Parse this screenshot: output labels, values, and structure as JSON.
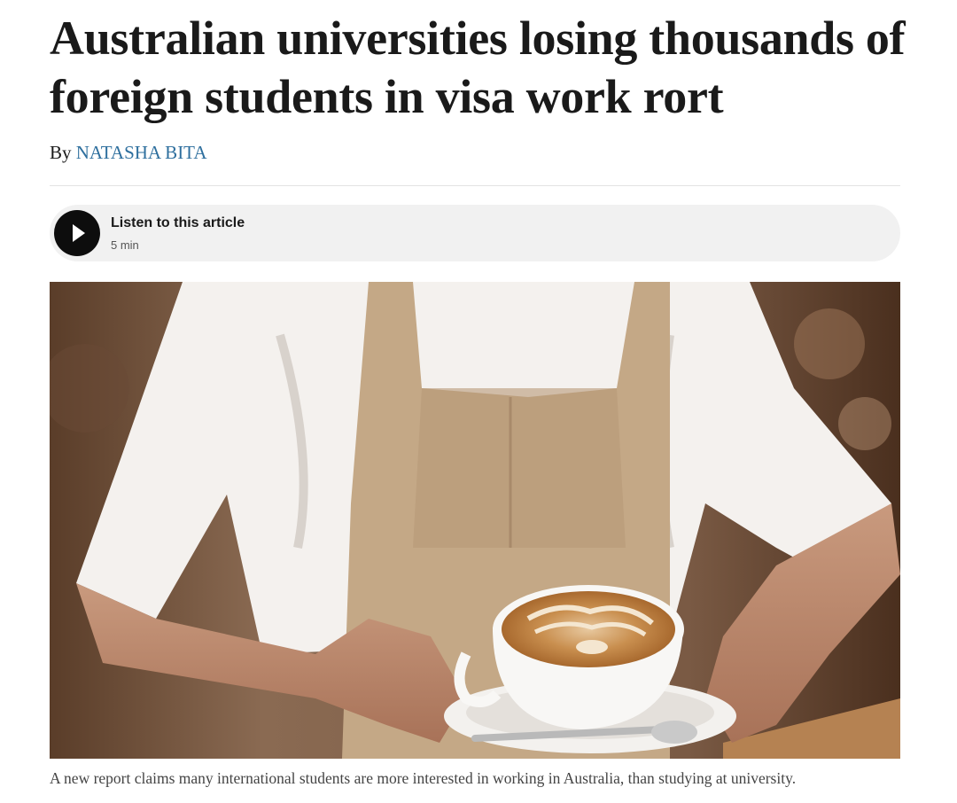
{
  "headline": "Australian universities losing thousands of foreign students in visa work rort",
  "byline": {
    "prefix": "By",
    "author": "NATASHA BITA"
  },
  "audio": {
    "title": "Listen to this article",
    "duration": "5 min",
    "icon": "play-icon"
  },
  "hero_image": {
    "subject": "barista-serving-latte-photo"
  },
  "caption": "A new report claims many international students are more interested in working in Australia, than studying at university.",
  "colors": {
    "author_link": "#2e6f9e",
    "text": "#1a1a1a",
    "audio_bg": "#f1f1f1",
    "play_button": "#0d0d0d"
  }
}
